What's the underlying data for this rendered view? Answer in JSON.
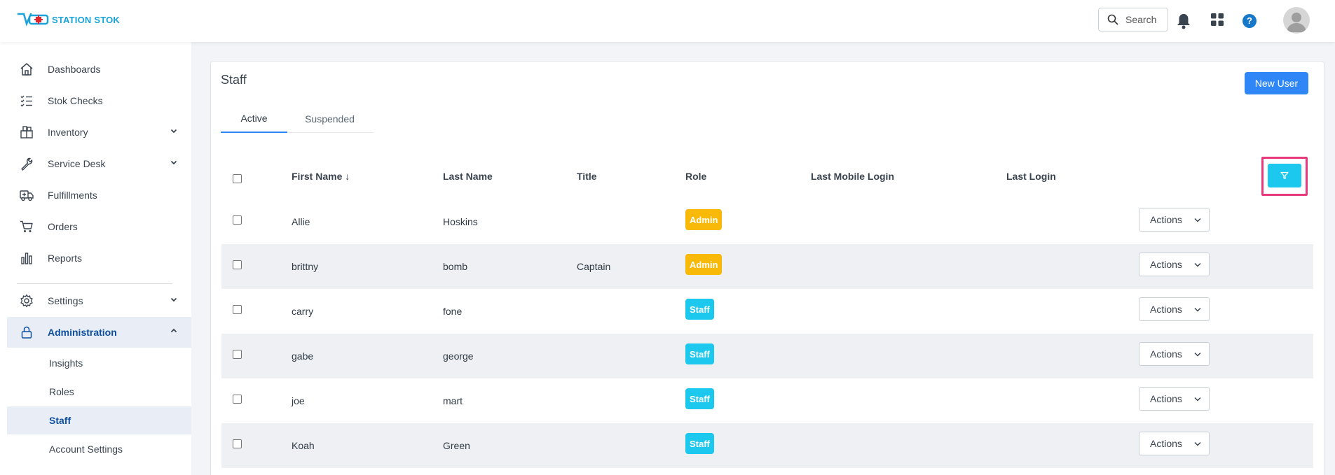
{
  "app": {
    "brand": "STATION STOK",
    "search_label": "Search"
  },
  "sidebar": {
    "items": [
      {
        "label": "Dashboards"
      },
      {
        "label": "Stok Checks"
      },
      {
        "label": "Inventory"
      },
      {
        "label": "Service Desk"
      },
      {
        "label": "Fulfillments"
      },
      {
        "label": "Orders"
      },
      {
        "label": "Reports"
      },
      {
        "label": "Settings"
      },
      {
        "label": "Administration"
      }
    ],
    "sub_items": [
      {
        "label": "Insights"
      },
      {
        "label": "Roles"
      },
      {
        "label": "Staff"
      },
      {
        "label": "Account Settings"
      }
    ]
  },
  "page": {
    "title": "Staff",
    "new_user_label": "New User",
    "tabs": [
      {
        "label": "Active"
      },
      {
        "label": "Suspended"
      }
    ]
  },
  "table": {
    "columns": [
      "First Name ↓",
      "Last Name",
      "Title",
      "Role",
      "Last Mobile Login",
      "Last Login"
    ],
    "rows": [
      {
        "first": "Allie",
        "last": "Hoskins",
        "title": "",
        "role": "Admin",
        "actions": "Actions"
      },
      {
        "first": "brittny",
        "last": "bomb",
        "title": "Captain",
        "role": "Admin",
        "actions": "Actions"
      },
      {
        "first": "carry",
        "last": "fone",
        "title": "",
        "role": "Staff",
        "actions": "Actions"
      },
      {
        "first": "gabe",
        "last": "george",
        "title": "",
        "role": "Staff",
        "actions": "Actions"
      },
      {
        "first": "joe",
        "last": "mart",
        "title": "",
        "role": "Staff",
        "actions": "Actions"
      },
      {
        "first": "Koah",
        "last": "Green",
        "title": "",
        "role": "Staff",
        "actions": "Actions"
      }
    ]
  },
  "colors": {
    "primary": "#2f86f6",
    "admin_badge": "#f9b908",
    "staff_badge": "#1cc8ee",
    "highlight": "#e8397d"
  }
}
